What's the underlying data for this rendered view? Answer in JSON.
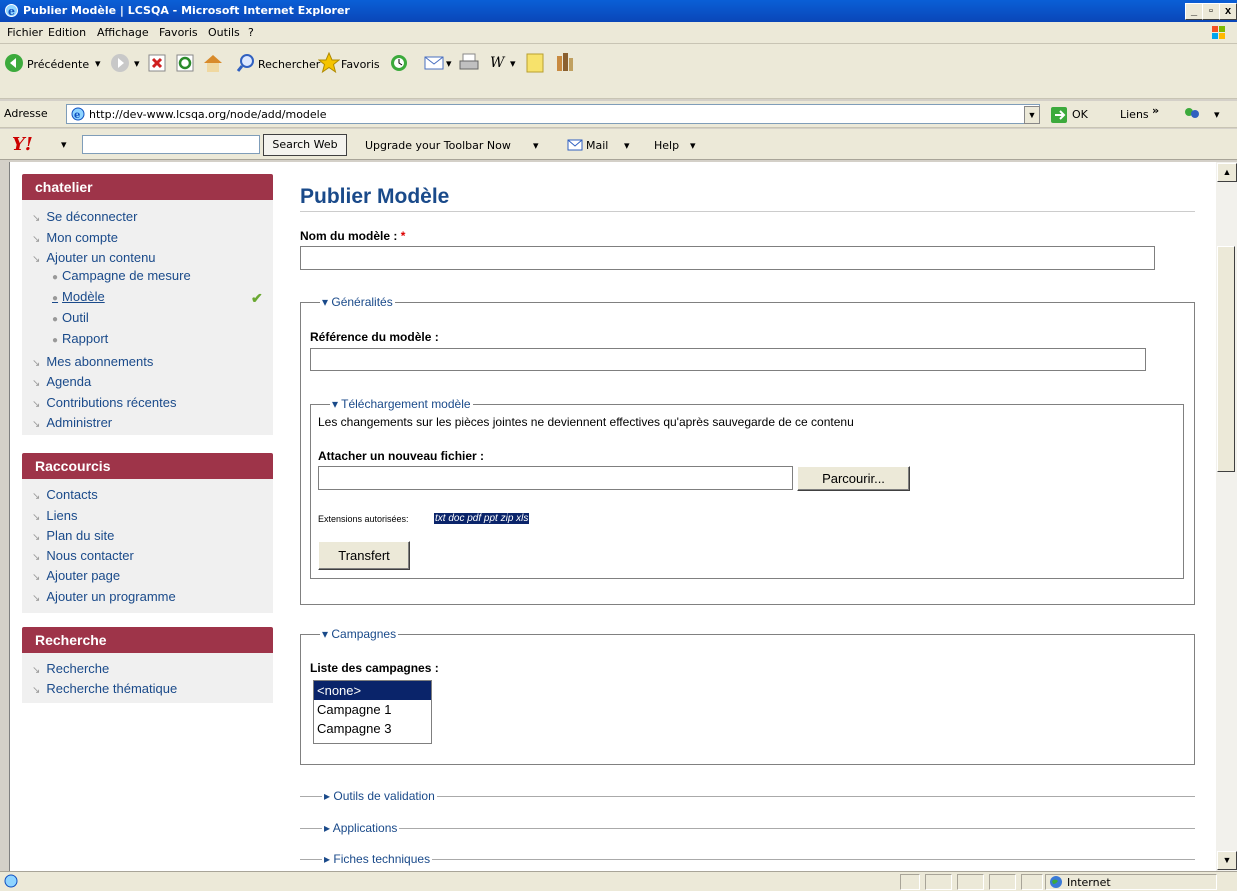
{
  "window": {
    "title": "Publier Modèle | LCSQA - Microsoft Internet Explorer",
    "min": "_",
    "max": "▫",
    "close": "x"
  },
  "menu": {
    "fichier": "Fichier",
    "edition": "Edition",
    "affichage": "Affichage",
    "favoris": "Favoris",
    "outils": "Outils",
    "aide": "?"
  },
  "toolbar": {
    "back": "Précédente",
    "search": "Rechercher",
    "favorites": "Favoris"
  },
  "address": {
    "label": "Adresse",
    "url": "http://dev-www.lcsqa.org/node/add/modele",
    "go": "OK",
    "links": "Liens"
  },
  "yahoo": {
    "search_btn": "Search Web",
    "upgrade": "Upgrade your Toolbar Now",
    "mail": "Mail",
    "help": "Help"
  },
  "sidebar": {
    "user_block": {
      "title": "chatelier",
      "items": [
        "Se déconnecter",
        "Mon compte",
        "Ajouter un contenu"
      ],
      "subitems": [
        "Campagne de mesure",
        "Modèle",
        "Outil",
        "Rapport"
      ],
      "items2": [
        "Mes abonnements",
        "Agenda",
        "Contributions récentes",
        "Administrer"
      ]
    },
    "shortcuts": {
      "title": "Raccourcis",
      "items": [
        "Contacts",
        "Liens",
        "Plan du site",
        "Nous contacter",
        "Ajouter page",
        "Ajouter un programme"
      ]
    },
    "search": {
      "title": "Recherche",
      "items": [
        "Recherche",
        "Recherche thématique"
      ]
    }
  },
  "main": {
    "title": "Publier Modèle",
    "name_label": "Nom du modèle :",
    "required": "*",
    "generalites": {
      "legend": "Généralités",
      "ref_label": "Référence du modèle :",
      "upload": {
        "legend": "Téléchargement modèle",
        "notice": "Les changements sur les pièces jointes ne deviennent effectives qu'après sauvegarde de ce contenu",
        "attach_label": "Attacher un nouveau fichier :",
        "browse": "Parcourir...",
        "ext_label": "Extensions autorisées:",
        "ext_values": "txt doc pdf ppt zip xls",
        "transfer": "Transfert"
      }
    },
    "campagnes": {
      "legend": "Campagnes",
      "list_label": "Liste des campagnes :",
      "options": [
        "<none>",
        "Campagne 1",
        "Campagne 3"
      ]
    },
    "collapsed": [
      "Outils de validation",
      "Applications",
      "Fiches techniques"
    ]
  },
  "status": {
    "zone": "Internet"
  }
}
